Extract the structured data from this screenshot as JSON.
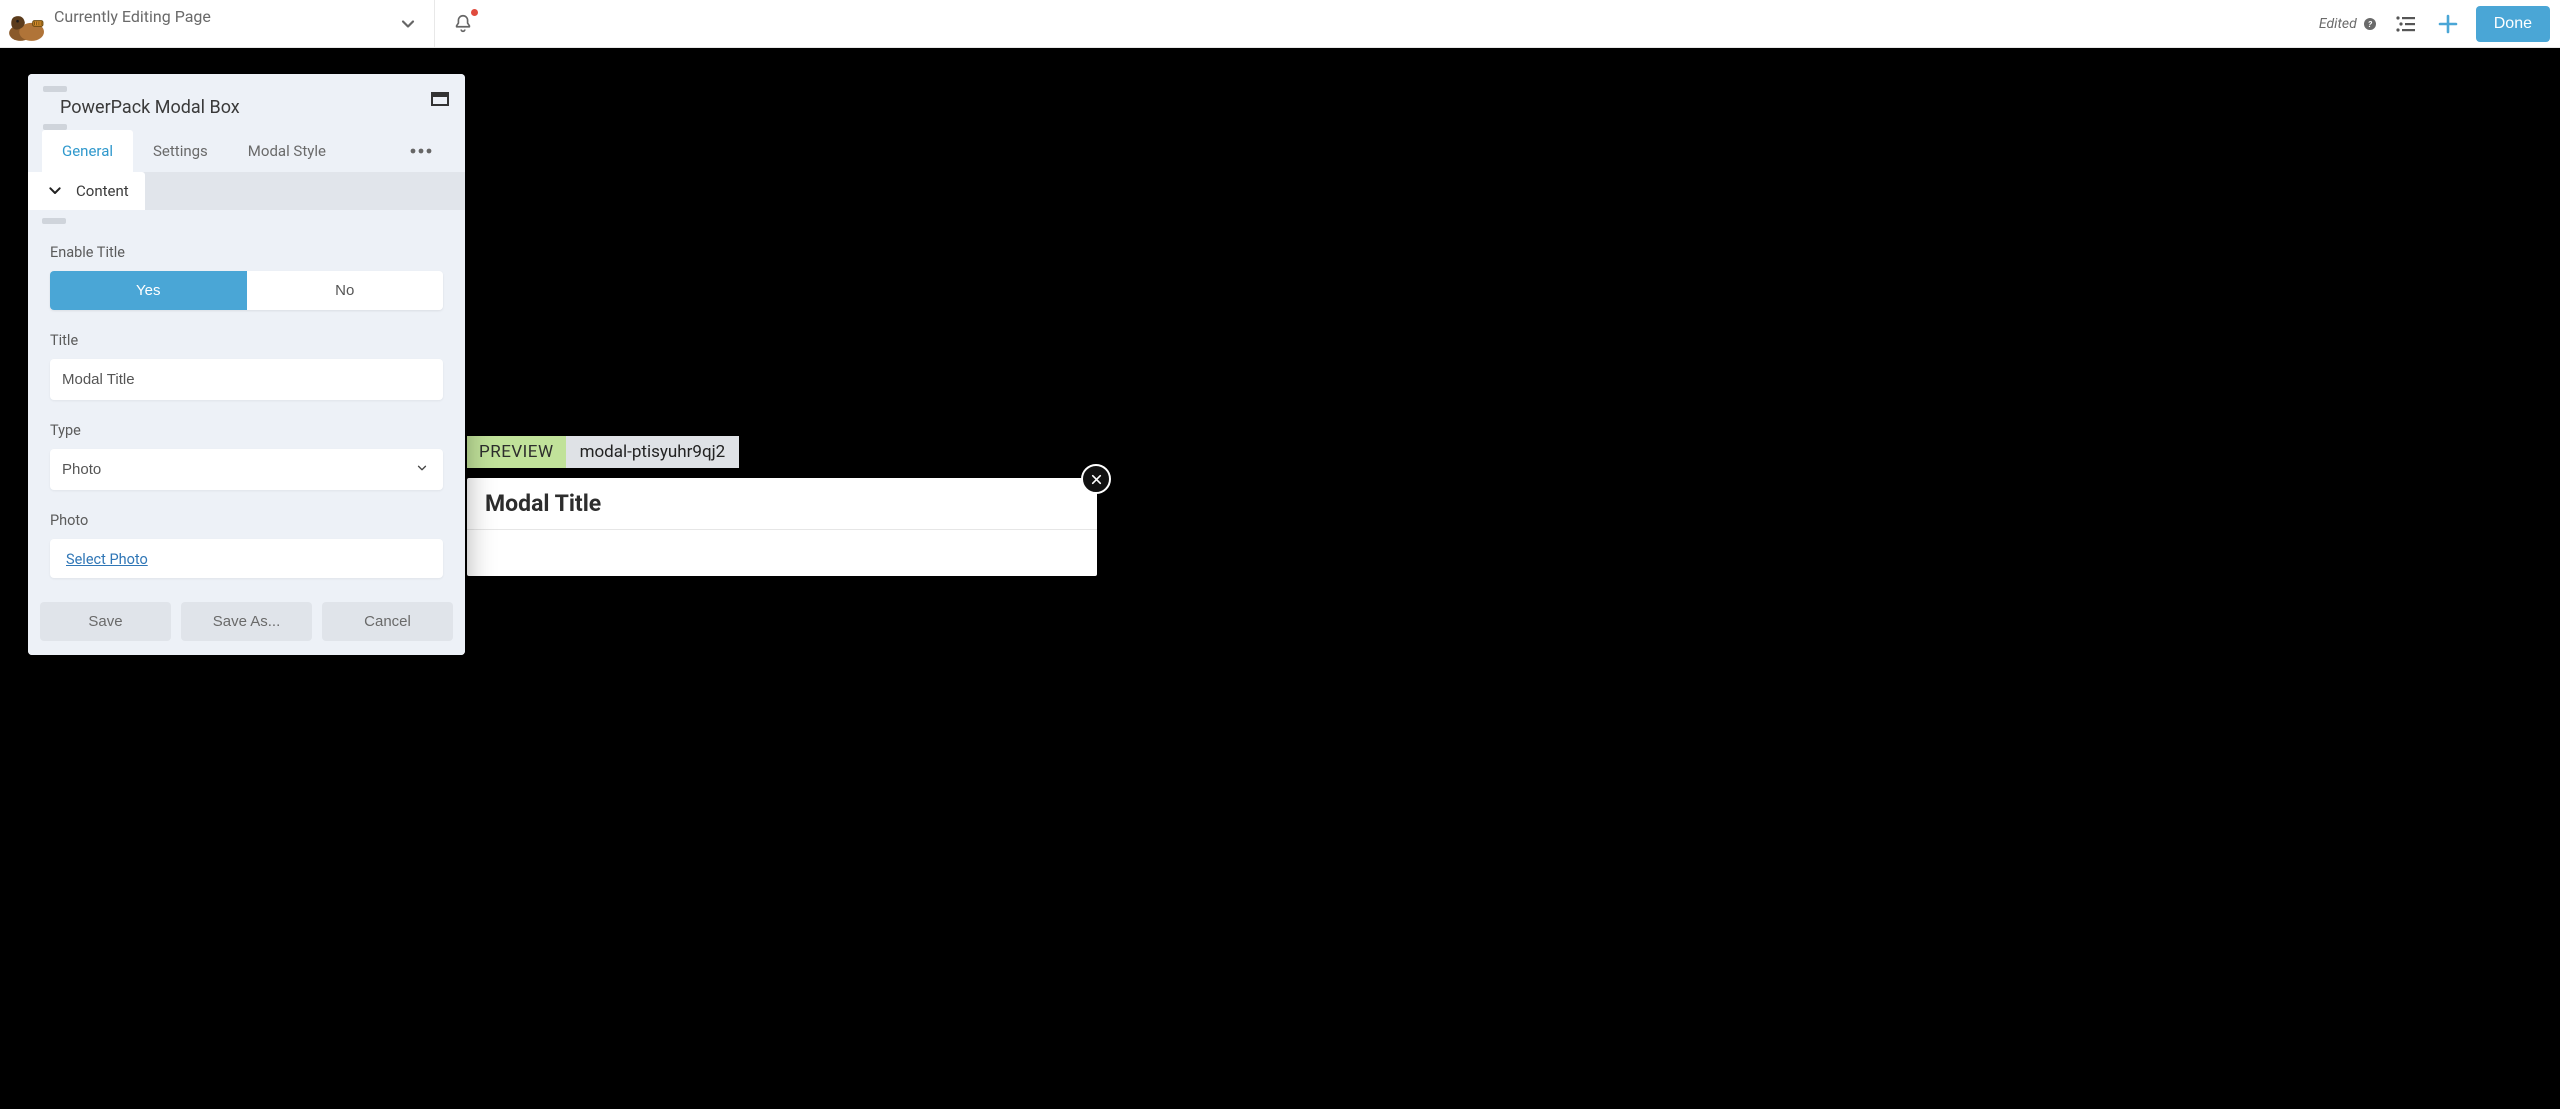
{
  "colors": {
    "accent": "#4aa6d6",
    "link": "#2f76b6",
    "alert": "#e04b3e"
  },
  "toolbar": {
    "page_title": "Currently Editing Page",
    "edited_label": "Edited",
    "done_label": "Done"
  },
  "panel": {
    "title": "PowerPack Modal Box",
    "tabs": [
      "General",
      "Settings",
      "Modal Style"
    ],
    "active_tab_index": 0,
    "subtab": "Content",
    "fields": {
      "enable_title": {
        "label": "Enable Title",
        "yes": "Yes",
        "no": "No",
        "value": "yes"
      },
      "title": {
        "label": "Title",
        "value": "Modal Title"
      },
      "type": {
        "label": "Type",
        "value": "Photo",
        "options": [
          "Photo"
        ]
      },
      "photo": {
        "label": "Photo",
        "select_label": "Select Photo"
      }
    },
    "footer": {
      "save": "Save",
      "save_as": "Save As...",
      "cancel": "Cancel"
    }
  },
  "preview": {
    "chip": "PREVIEW",
    "id": "modal-ptisyuhr9qj2",
    "modal_title": "Modal Title"
  }
}
